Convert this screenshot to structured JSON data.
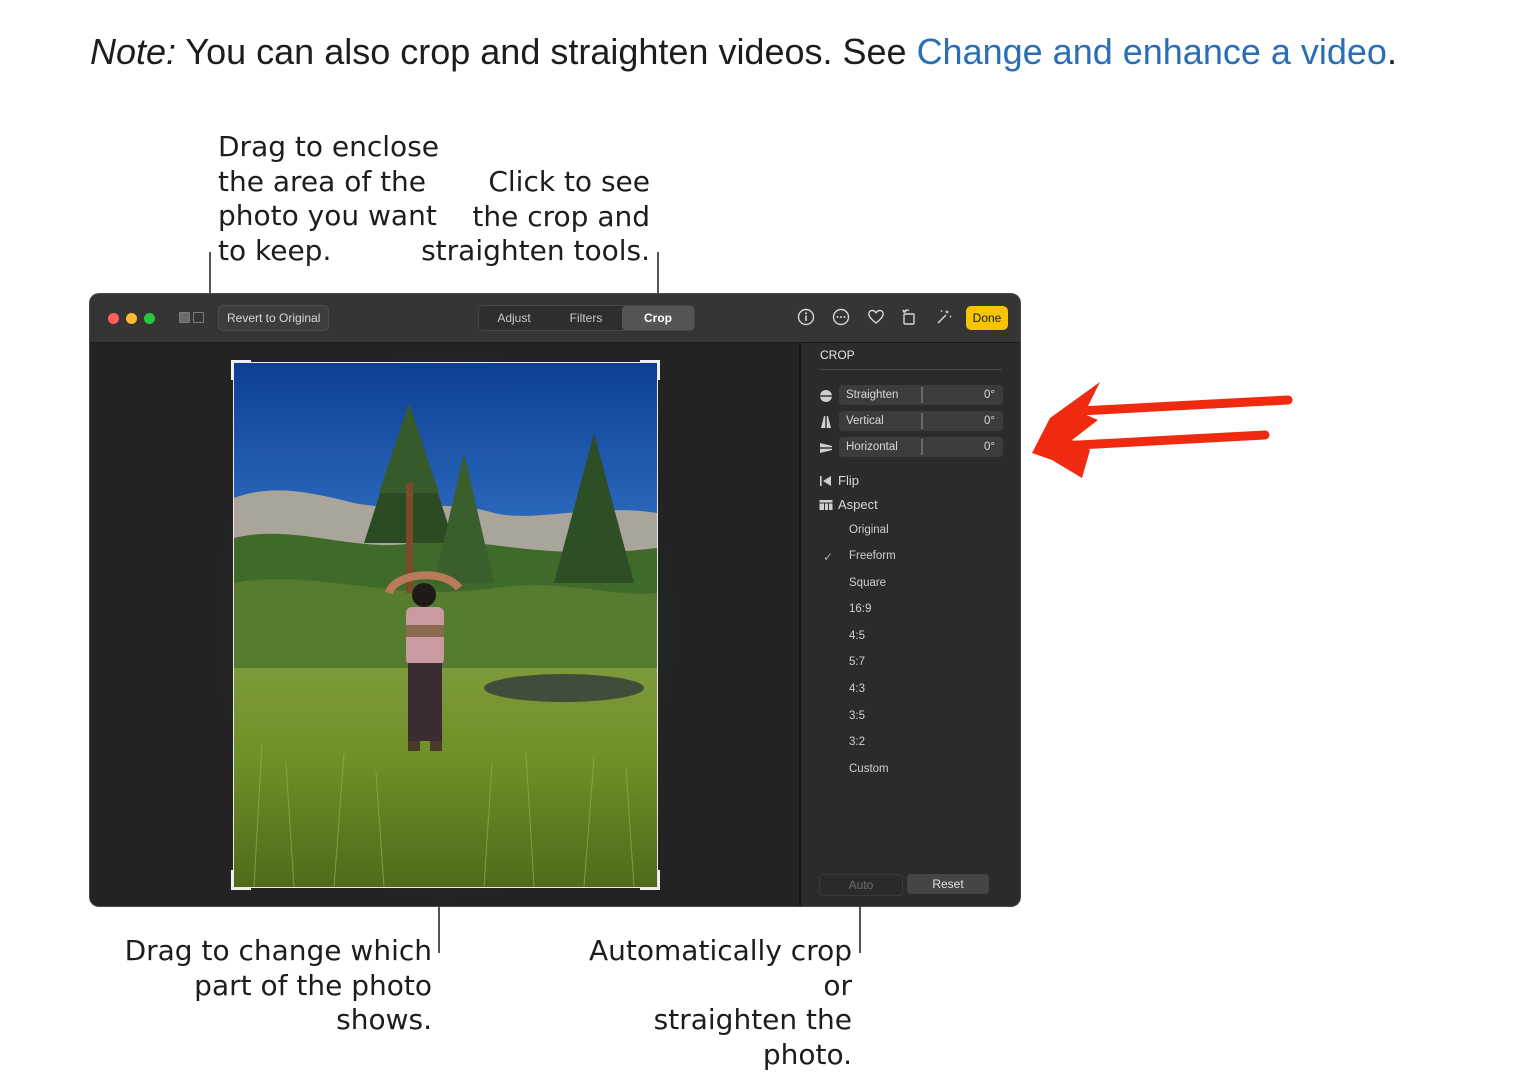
{
  "note": {
    "prefix": "Note:",
    "text": " You can also crop and straighten videos. See ",
    "link": "Change and enhance a video",
    "suffix": "."
  },
  "callouts": {
    "drag_enclose": "Drag to enclose\nthe area of the\nphoto you want\nto keep.",
    "click_tools": "Click to see\nthe crop and\nstraighten tools.",
    "drag_change": "Drag to change which\npart of the photo shows.",
    "auto_crop": "Automatically crop or\nstraighten the photo."
  },
  "toolbar": {
    "revert_label": "Revert to Original",
    "tabs": [
      {
        "label": "Adjust",
        "active": false
      },
      {
        "label": "Filters",
        "active": false
      },
      {
        "label": "Crop",
        "active": true
      }
    ],
    "icons": [
      "info-icon",
      "more-icon",
      "heart-icon",
      "rotate-icon",
      "magic-wand-icon"
    ],
    "done_label": "Done"
  },
  "panel": {
    "title": "CROP",
    "sliders": [
      {
        "label": "Straighten",
        "value": "0°",
        "icon": "straighten-icon"
      },
      {
        "label": "Vertical",
        "value": "0°",
        "icon": "vertical-perspective-icon"
      },
      {
        "label": "Horizontal",
        "value": "0°",
        "icon": "horizontal-perspective-icon"
      }
    ],
    "flip_label": "Flip",
    "aspect_label": "Aspect",
    "aspect_options": [
      "Original",
      "Freeform",
      "Square",
      "16:9",
      "4:5",
      "5:7",
      "4:3",
      "3:5",
      "3:2",
      "Custom"
    ],
    "aspect_selected": "Freeform",
    "auto_label": "Auto",
    "reset_label": "Reset"
  },
  "colors": {
    "link": "#2a6fb5",
    "done_button": "#f7c400",
    "annotation_arrow": "#ef2a10",
    "close": "#fe5f57",
    "minimize": "#febc2e",
    "zoom": "#28c840"
  }
}
